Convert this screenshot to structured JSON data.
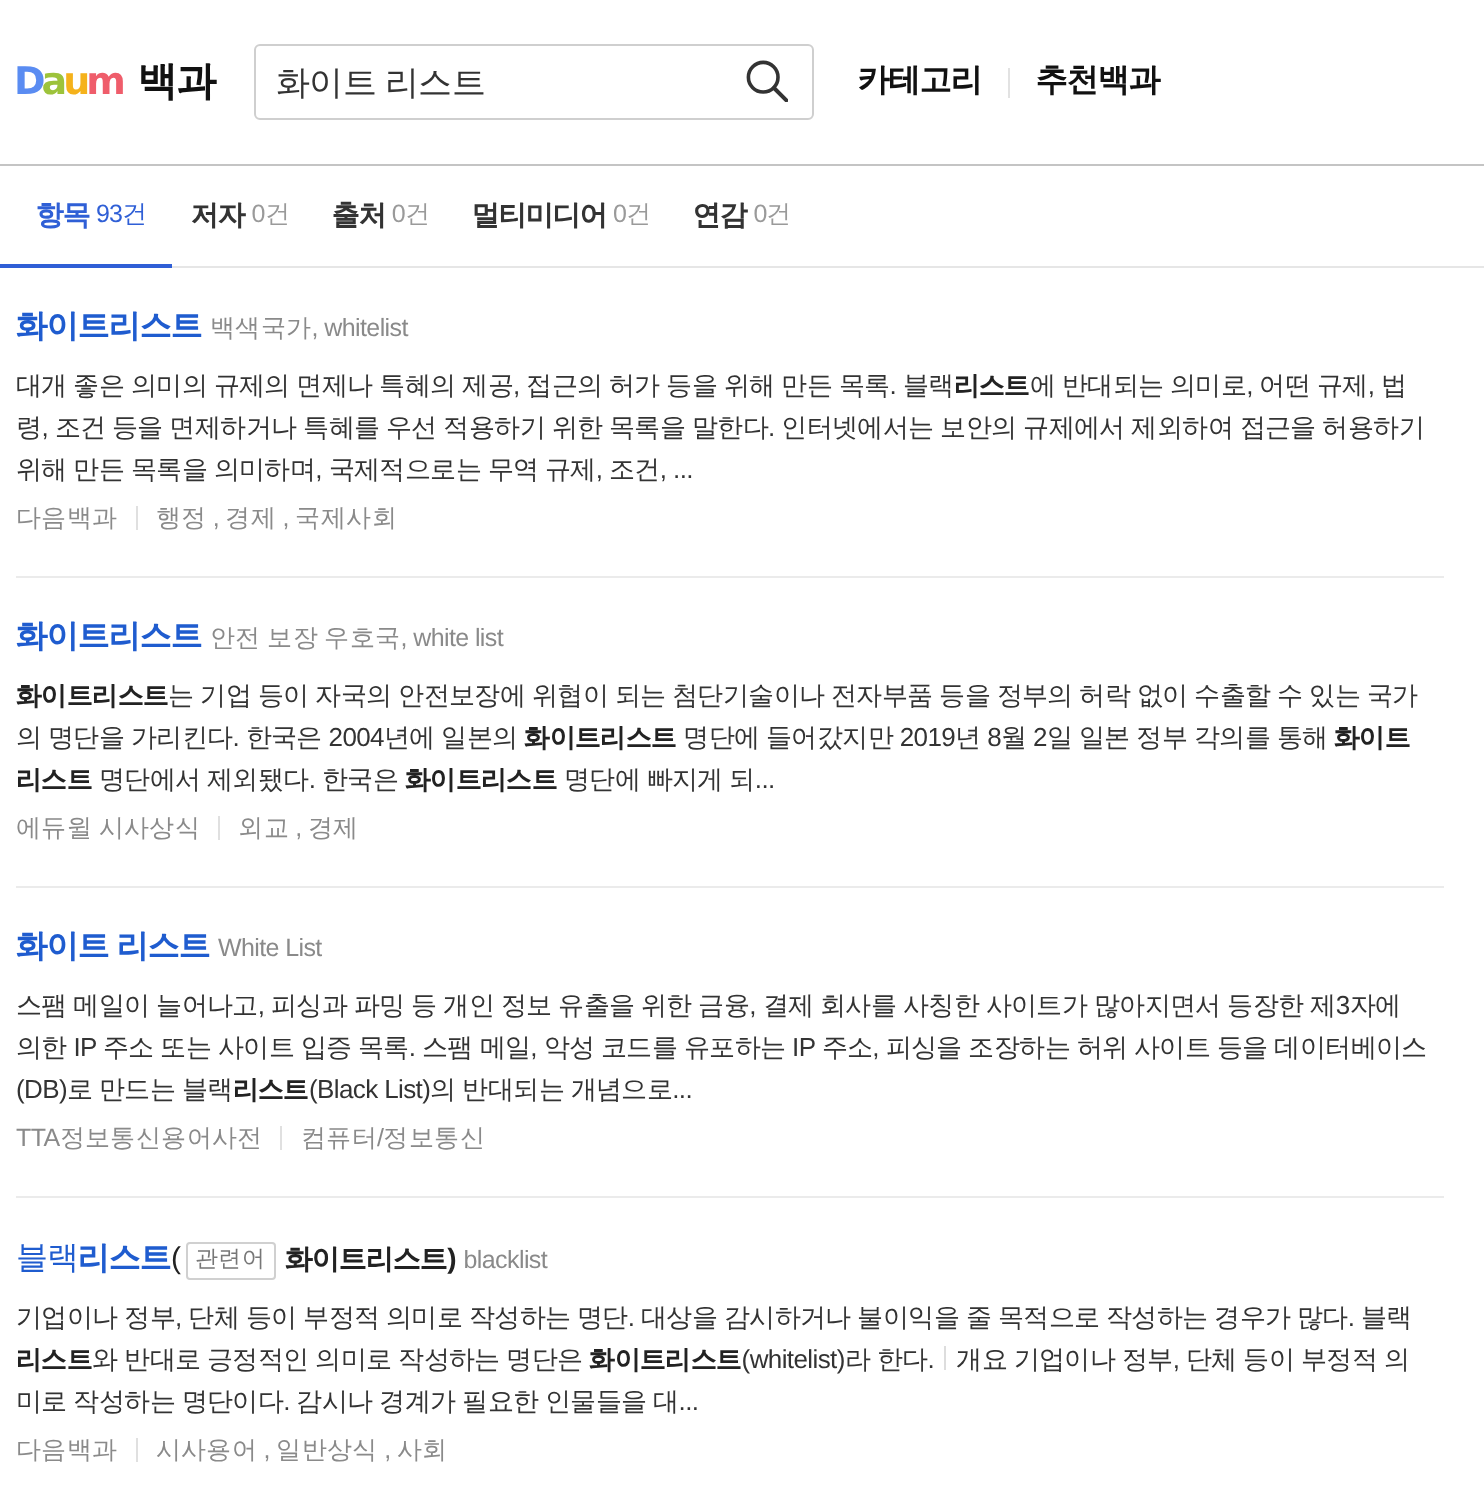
{
  "header": {
    "logo": "Daum",
    "service": "백과",
    "search": {
      "value": "화이트 리스트"
    },
    "nav": [
      "카테고리",
      "추천백과"
    ]
  },
  "tabs": [
    {
      "label": "항목",
      "count": "93건",
      "selected": true
    },
    {
      "label": "저자",
      "count": "0건",
      "selected": false
    },
    {
      "label": "출처",
      "count": "0건",
      "selected": false
    },
    {
      "label": "멀티미디어",
      "count": "0건",
      "selected": false
    },
    {
      "label": "연감",
      "count": "0건",
      "selected": false
    }
  ],
  "results": [
    {
      "title": "화이트리스트",
      "title_bold": true,
      "subtitle": "백색국가, whitelist",
      "snippet": [
        "대개 좋은 의미의 규제의 면제나 특혜의 제공, 접근의 허가 등을 위해 만든 목록. 블랙**리스트**에 반대되는 의미로, 어떤 규제, 법령, 조건 등을 면제하거나 특혜를 우선 적용하기 위한 목록을 말한다. 인터넷에서는 보안의 규제에서 제외하여 접근을 허용하기 위해 만든 목록을 의미하며, 국제적으로는 무역 규제, 조건, ..."
      ],
      "source": "다음백과",
      "category": "행정 , 경제 , 국제사회"
    },
    {
      "title": "화이트리스트",
      "title_bold": true,
      "subtitle": "안전 보장 우호국, white list",
      "snippet": [
        "**화이트리스트**는 기업 등이 자국의 안전보장에 위협이 되는 첨단기술이나 전자부품 등을 정부의 허락 없이 수출할 수 있는 국가의 명단을 가리킨다. 한국은 2004년에 일본의 **화이트리스트** 명단에 들어갔지만 2019년 8월 2일 일본 정부 각의를 통해 **화이트리스트** 명단에서 제외됐다. 한국은 **화이트리스트** 명단에 빠지게 되..."
      ],
      "source": "에듀윌 시사상식",
      "category": "외교 , 경제"
    },
    {
      "title": "화이트 리스트",
      "title_bold": true,
      "subtitle": "White List",
      "snippet": [
        "스팸 메일이 늘어나고, 피싱과 파밍 등 개인 정보 유출을 위한 금융, 결제 회사를 사칭한 사이트가 많아지면서 등장한 제3자에 의한 IP 주소 또는 사이트 입증 목록. 스팸 메일, 악성 코드를 유포하는 IP 주소, 피싱을 조장하는 허위 사이트 등을 데이터베이스(DB)로 만드는 블랙**리스트**(Black List)의 반대되는 개념으로..."
      ],
      "source": "TTA정보통신용어사전",
      "category": "컴퓨터/정보통신"
    },
    {
      "title": "블랙**리스트**",
      "title_bold": false,
      "related": {
        "open": "(",
        "tag": "관련어",
        "term": "화이트리스트)"
      },
      "subtitle": "blacklist",
      "snippet": [
        "기업이나 정부, 단체 등이 부정적 의미로 작성하는 명단. 대상을 감시하거나 불이익을 줄 목적으로 작성하는 경우가 많다. 블랙**리스트**와 반대로 긍정적인 의미로 작성하는 명단은 **화이트리스트**(whitelist)라 한다.",
        "개요 기업이나 정부, 단체 등이 부정적 의미로 작성하는 명단이다. 감시나 경계가 필요한 인물들을 대..."
      ],
      "source": "다음백과",
      "category": "시사용어 , 일반상식 , 사회"
    }
  ]
}
